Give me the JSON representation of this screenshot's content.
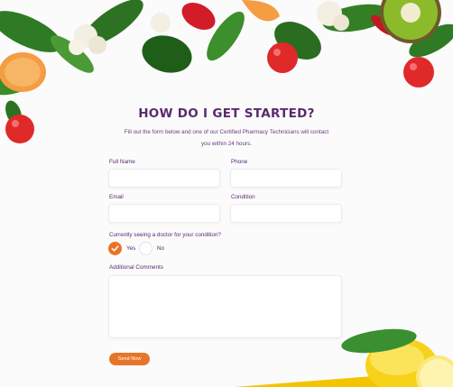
{
  "header": {
    "title": "HOW DO I GET STARTED?",
    "intro_line1": "Fill out the form below and one of our Certified Pharmacy Technicians will contact",
    "intro_line2": "you within 24 hours."
  },
  "form": {
    "full_name": {
      "label": "Full Name",
      "value": "",
      "placeholder": ""
    },
    "phone": {
      "label": "Phone",
      "value": "",
      "placeholder": ""
    },
    "email": {
      "label": "Email",
      "value": "",
      "placeholder": ""
    },
    "condition": {
      "label": "Condition",
      "value": "",
      "placeholder": ""
    },
    "doctor_question": "Currently seeing a doctor for your condition?",
    "options": {
      "yes": "Yes",
      "no": "No",
      "selected": "Yes"
    },
    "comments": {
      "label": "Additional Comments",
      "value": "",
      "placeholder": ""
    },
    "submit_label": "Send Now"
  },
  "colors": {
    "title": "#5a2a6e",
    "accent": "#e8742a",
    "lemon": "#f5c400"
  },
  "decorations": [
    "spinach-leaves",
    "cauliflower",
    "red-pepper",
    "tangerine-slice",
    "cherry-tomato",
    "kiwi",
    "lemon",
    "yellow-stripe"
  ]
}
